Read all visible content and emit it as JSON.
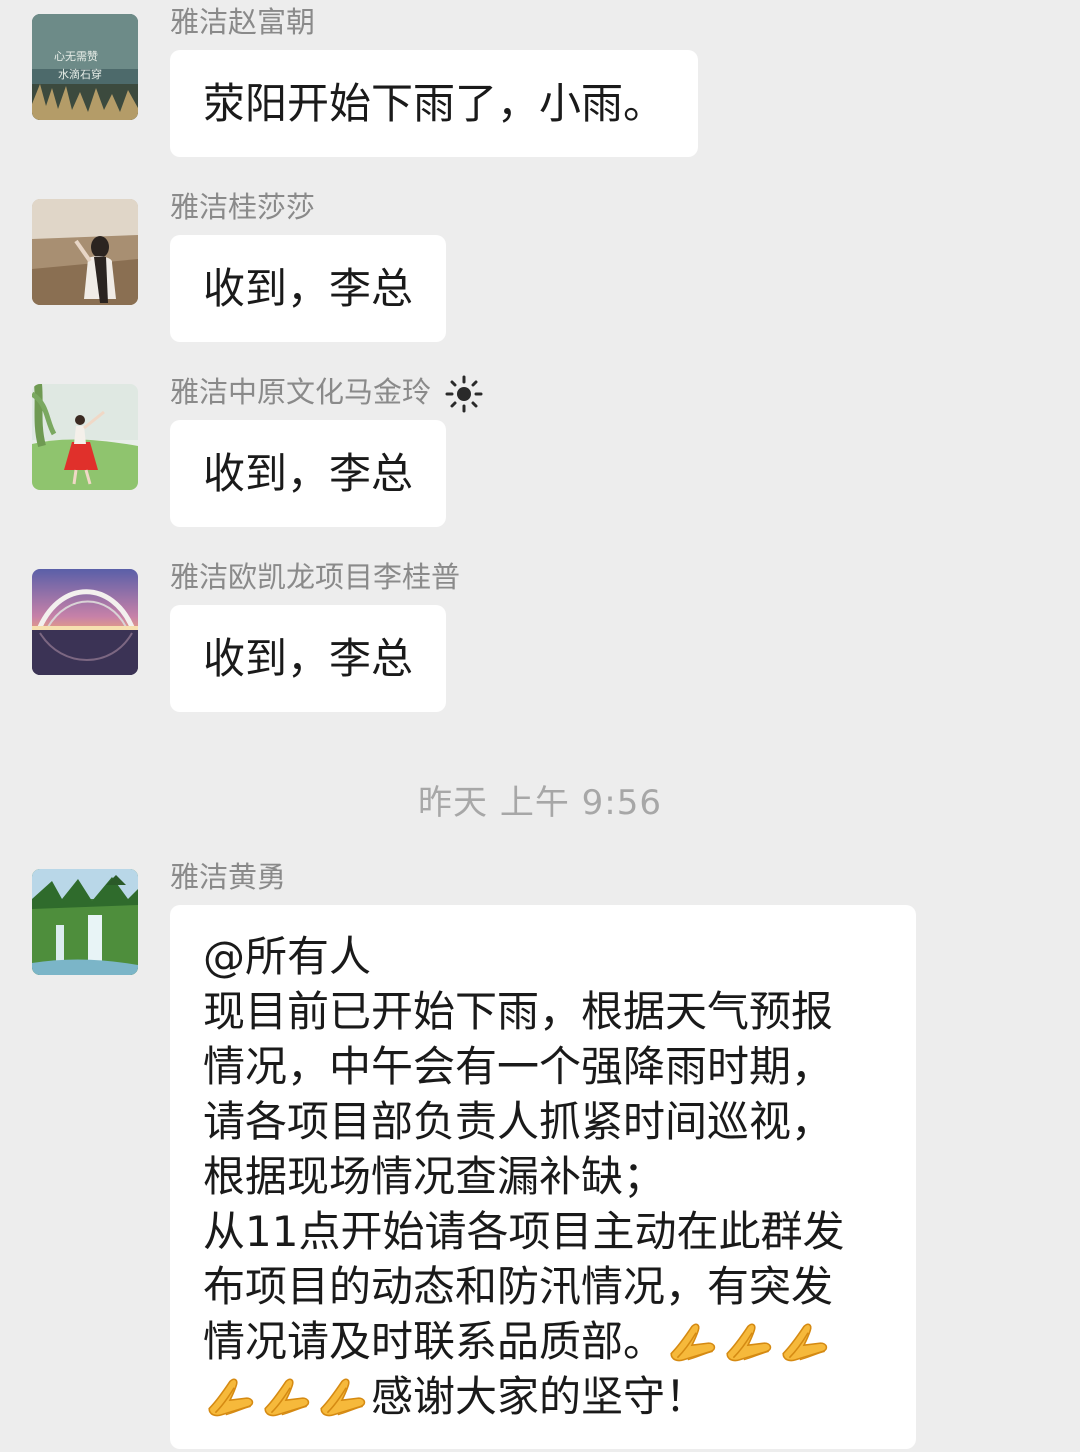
{
  "messages": [
    {
      "sender": "雅洁赵富朝",
      "text": "荥阳开始下雨了，小雨。",
      "avatar_icon": "calligraphy-avatar"
    },
    {
      "sender": "雅洁桂莎莎",
      "text": "收到，李总",
      "avatar_icon": "field-person-avatar"
    },
    {
      "sender": "雅洁中原文化马金玲",
      "text": "收到，李总",
      "avatar_icon": "red-dress-avatar",
      "status_icon": "sun-icon"
    },
    {
      "sender": "雅洁欧凯龙项目李桂普",
      "text": "收到，李总",
      "avatar_icon": "bridge-avatar"
    }
  ],
  "timestamp": "昨天 上午 9:56",
  "long_message": {
    "sender": "雅洁黄勇",
    "avatar_icon": "waterfall-avatar",
    "lines": [
      "@所有人",
      "现目前已开始下雨，根据天气预报",
      "情况，中午会有一个强降雨时期，",
      "请各项目部负责人抓紧时间巡视，",
      "根据现场情况查漏补缺；",
      "从11点开始请各项目主动在此群发",
      "布项目的动态和防汛情况，有突发",
      "情况请及时联系品质部。",
      "感谢大家的坚守！"
    ],
    "emoji": "pray-hands-icon"
  },
  "colors": {
    "background": "#ededed",
    "bubble": "#ffffff",
    "sender_text": "#8a8a8a",
    "timestamp_text": "#a7a7a7"
  }
}
